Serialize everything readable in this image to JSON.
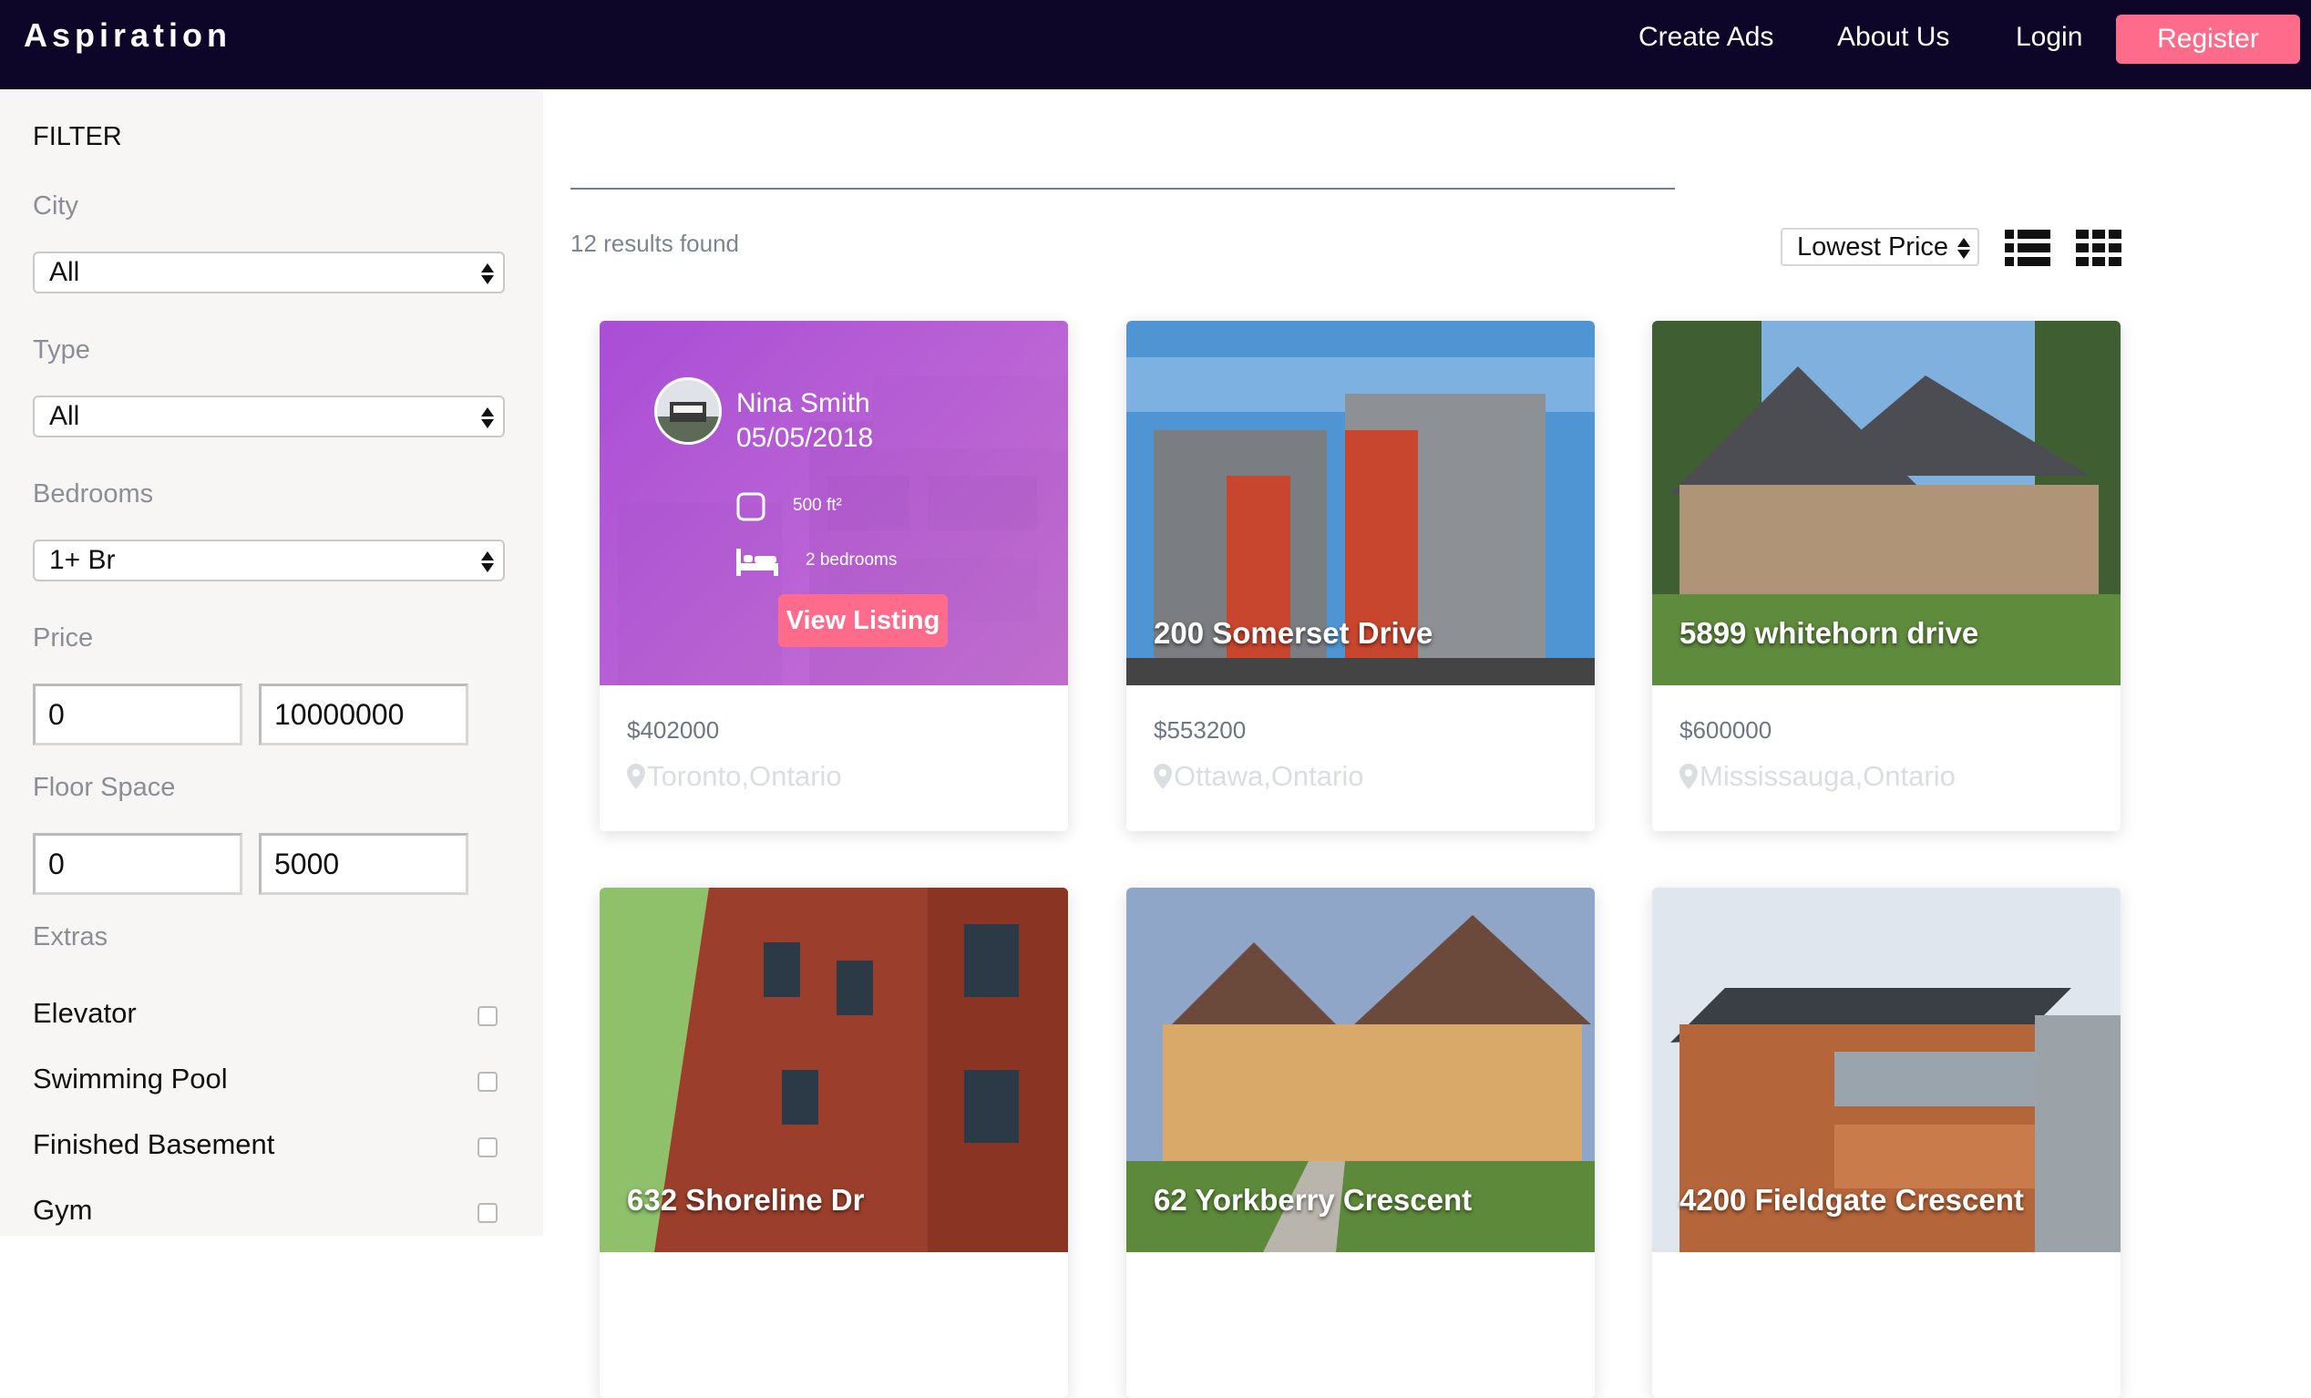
{
  "brand": "Aspiration",
  "nav": {
    "create_ads": "Create Ads",
    "about_us": "About Us",
    "login": "Login",
    "register": "Register"
  },
  "filter": {
    "title": "FILTER",
    "city": {
      "label": "City",
      "value": "All"
    },
    "type": {
      "label": "Type",
      "value": "All"
    },
    "bedrooms": {
      "label": "Bedrooms",
      "value": "1+ Br"
    },
    "price": {
      "label": "Price",
      "min": "0",
      "max": "10000000"
    },
    "floor_space": {
      "label": "Floor Space",
      "min": "0",
      "max": "5000"
    },
    "extras": {
      "label": "Extras",
      "items": [
        {
          "label": "Elevator",
          "checked": false
        },
        {
          "label": "Swimming Pool",
          "checked": false
        },
        {
          "label": "Finished Basement",
          "checked": false
        },
        {
          "label": "Gym",
          "checked": false
        }
      ]
    }
  },
  "results": {
    "count_text": "12 results found",
    "sort_value": "Lowest Price"
  },
  "listings": [
    {
      "title": "",
      "price": "$402000",
      "location": "Toronto,Ontario",
      "hover": {
        "agent_name": "Nina Smith",
        "date": "05/05/2018",
        "floor_space": "500 ft²",
        "bedrooms": "2 bedrooms",
        "button": "View Listing"
      }
    },
    {
      "title": "200 Somerset Drive",
      "price": "$553200",
      "location": "Ottawa,Ontario"
    },
    {
      "title": "5899 whitehorn drive",
      "price": "$600000",
      "location": "Mississauga,Ontario"
    },
    {
      "title": "632 Shoreline Dr",
      "price": "",
      "location": ""
    },
    {
      "title": "62 Yorkberry Crescent",
      "price": "",
      "location": ""
    },
    {
      "title": "4200 Fieldgate Crescent",
      "price": "",
      "location": ""
    }
  ],
  "colors": {
    "navbar_bg": "#0d0628",
    "accent": "#ff6b8a",
    "sidebar_bg": "#f8f6f4",
    "overlay_purple": "#a848d6"
  }
}
